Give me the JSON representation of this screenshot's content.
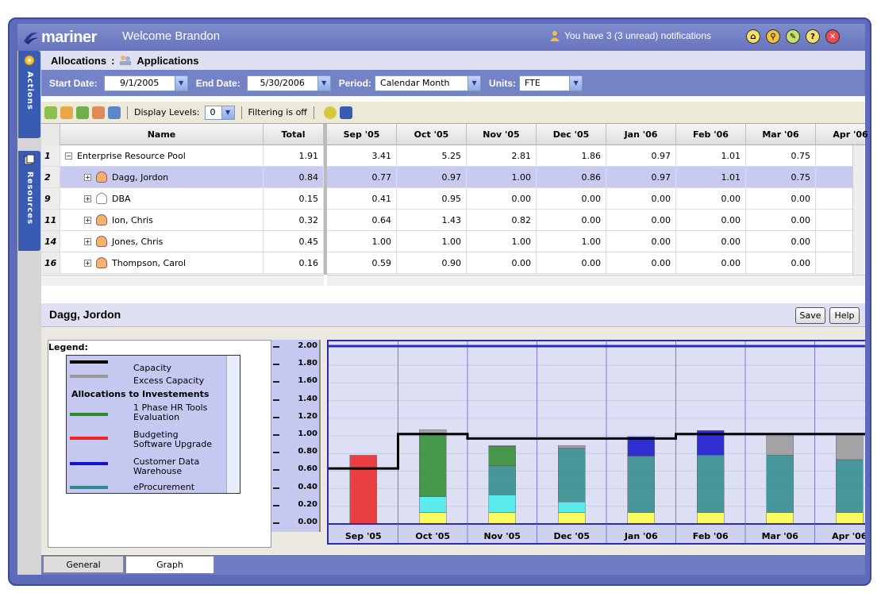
{
  "app": {
    "name": "mariner",
    "welcome": "Welcome Brandon",
    "notifications": "You have 3 (3 unread) notifications"
  },
  "sidebar": {
    "actions": "Actions",
    "resources": "Resources"
  },
  "breadcrumb": {
    "root": "Allocations",
    "separator": ":",
    "current": "Applications"
  },
  "filters": {
    "start_label": "Start Date:",
    "start_value": "9/1/2005",
    "end_label": "End Date:",
    "end_value": "5/30/2006",
    "period_label": "Period:",
    "period_value": "Calendar Month",
    "units_label": "Units:",
    "units_value": "FTE"
  },
  "toolbar": {
    "display_levels_label": "Display Levels:",
    "display_levels_value": "0",
    "filtering": "Filtering is off"
  },
  "grid": {
    "columns": {
      "name": "Name",
      "total": "Total",
      "months": [
        "Sep '05",
        "Oct '05",
        "Nov '05",
        "Dec '05",
        "Jan '06",
        "Feb '06",
        "Mar '06",
        "Apr '06"
      ]
    },
    "rows": [
      {
        "num": "1",
        "name": "Enterprise Resource Pool",
        "total": "1.91",
        "vals": [
          "3.41",
          "5.25",
          "2.81",
          "1.86",
          "0.97",
          "1.01",
          "0.75"
        ],
        "type": "pool",
        "selected": false
      },
      {
        "num": "2",
        "name": "Dagg, Jordon",
        "total": "0.84",
        "vals": [
          "0.77",
          "0.97",
          "1.00",
          "0.86",
          "0.97",
          "1.01",
          "0.75"
        ],
        "type": "person",
        "selected": true
      },
      {
        "num": "9",
        "name": "DBA",
        "total": "0.15",
        "vals": [
          "0.41",
          "0.95",
          "0.00",
          "0.00",
          "0.00",
          "0.00",
          "0.00"
        ],
        "type": "group",
        "selected": false
      },
      {
        "num": "11",
        "name": "Ion, Chris",
        "total": "0.32",
        "vals": [
          "0.64",
          "1.43",
          "0.82",
          "0.00",
          "0.00",
          "0.00",
          "0.00"
        ],
        "type": "person",
        "selected": false
      },
      {
        "num": "14",
        "name": "Jones, Chris",
        "total": "0.45",
        "vals": [
          "1.00",
          "1.00",
          "1.00",
          "1.00",
          "0.00",
          "0.00",
          "0.00"
        ],
        "type": "person",
        "selected": false
      },
      {
        "num": "16",
        "name": "Thompson, Carol",
        "total": "0.16",
        "vals": [
          "0.59",
          "0.90",
          "0.00",
          "0.00",
          "0.00",
          "0.00",
          "0.00"
        ],
        "type": "person",
        "selected": false
      }
    ]
  },
  "detail": {
    "name": "Dagg, Jordon",
    "save": "Save",
    "help": "Help"
  },
  "legend": {
    "title": "Legend:",
    "items": [
      {
        "label": "Capacity",
        "color": "#000000"
      },
      {
        "label": "Excess Capacity",
        "color": "#999999"
      }
    ],
    "group": "Allocations to Investements",
    "allocations": [
      {
        "label": "1 Phase HR Tools Evaluation",
        "color": "#2e8b2e"
      },
      {
        "label": "Budgeting Software Upgrade",
        "color": "#ee2222"
      },
      {
        "label": "Customer Data Warehouse",
        "color": "#1111cc"
      },
      {
        "label": "eProcurement",
        "color": "#2e8b8b"
      }
    ]
  },
  "chart_data": {
    "type": "bar",
    "categories": [
      "Sep '05",
      "Oct '05",
      "Nov '05",
      "Dec '05",
      "Jan '06",
      "Feb '06",
      "Mar '06",
      "Apr '06"
    ],
    "yticks": [
      "2.00",
      "1.80",
      "1.60",
      "1.40",
      "1.20",
      "1.00",
      "0.80",
      "0.60",
      "0.40",
      "0.20",
      "0.00"
    ],
    "ylim": [
      0,
      2.0
    ],
    "capacity": [
      0.63,
      1.02,
      0.97,
      0.97,
      0.97,
      1.02,
      1.02,
      1.02
    ],
    "series": [
      {
        "color": "#ffff44",
        "values": [
          0,
          0.13,
          0.13,
          0.13,
          0.13,
          0.13,
          0.13,
          0.13
        ]
      },
      {
        "color": "#44eeee",
        "values": [
          0,
          0.18,
          0.2,
          0.12,
          0,
          0,
          0,
          0
        ]
      },
      {
        "color": "#2e8b8b",
        "values": [
          0,
          0,
          0.33,
          0.61,
          0.64,
          0.65,
          0.65,
          0.6
        ]
      },
      {
        "color": "#2e8b2e",
        "values": [
          0,
          0.72,
          0.22,
          0,
          0,
          0,
          0,
          0
        ]
      },
      {
        "color": "#ee2222",
        "values": [
          0.78,
          0,
          0,
          0,
          0,
          0,
          0,
          0
        ]
      },
      {
        "color": "#1111cc",
        "values": [
          0,
          0,
          0,
          0,
          0.22,
          0.28,
          0,
          0
        ]
      },
      {
        "color": "#999999",
        "values": [
          0,
          0.04,
          0.01,
          0.03,
          0,
          0,
          0.22,
          0.28
        ]
      }
    ]
  },
  "tabs": {
    "general": "General",
    "graph": "Graph"
  }
}
